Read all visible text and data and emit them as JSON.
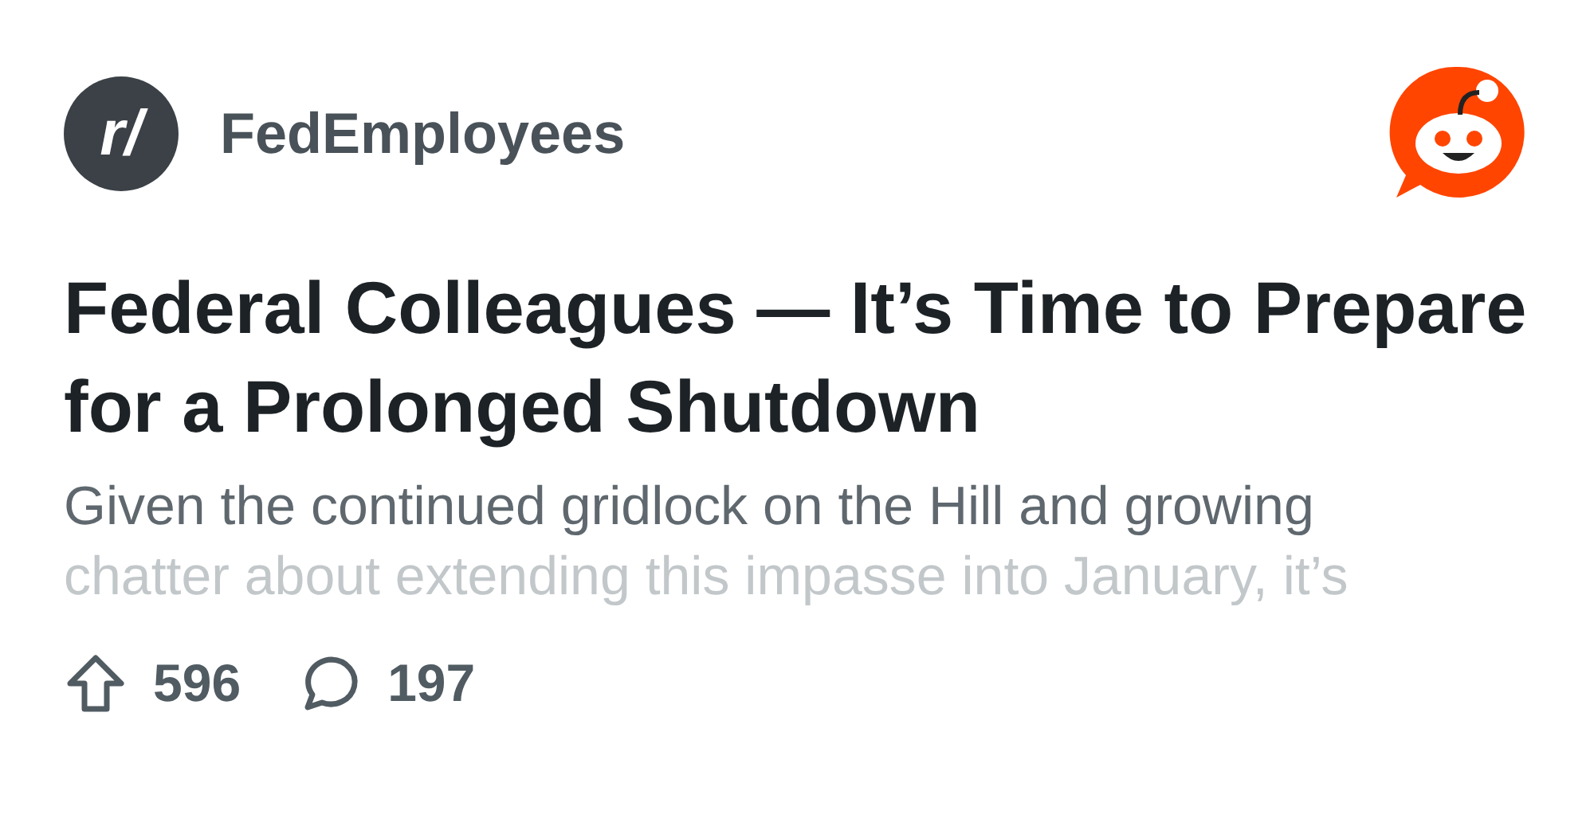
{
  "subreddit": {
    "avatar_text": "r/",
    "name": "FedEmployees"
  },
  "title": "Federal Colleagues — It’s Time to Prepare for a Prolonged Shutdown",
  "excerpt_lines": [
    {
      "text": "Given the continued gridlock on the Hill and growing",
      "faded": false
    },
    {
      "text": "chatter about extending this impasse into January, it’s",
      "faded": true
    }
  ],
  "stats": {
    "upvotes": "596",
    "comments": "197"
  }
}
